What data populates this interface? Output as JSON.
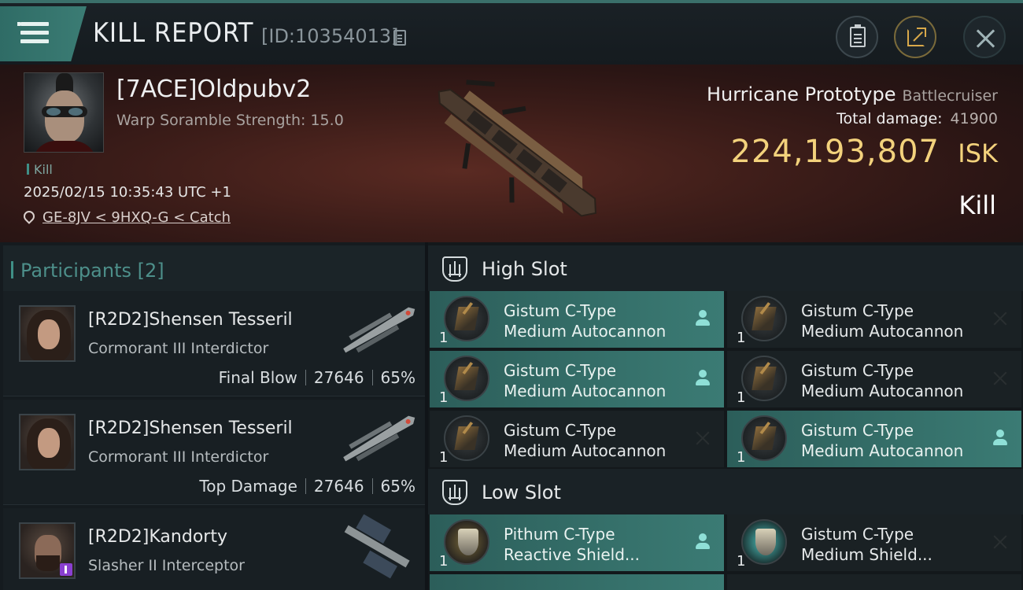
{
  "header": {
    "title": "KILL REPORT",
    "report_id": "[ID:10354013]"
  },
  "victim": {
    "name": "[7ACE]Oldpubv2",
    "warp_scramble": "Warp Soramble Strength: 15.0",
    "tag": "Kill",
    "timestamp": "2025/02/15 10:35:43 UTC +1",
    "location": "GE-8JV < 9HXQ-G < Catch",
    "ship_name": "Hurricane Prototype",
    "ship_class": "Battlecruiser",
    "total_damage_label": "Total damage:",
    "total_damage": "41900",
    "isk_value": "224,193,807",
    "isk_label": "ISK",
    "result": "Kill"
  },
  "participants": {
    "title": "Participants [2]",
    "rows": [
      {
        "name": "[R2D2]Shensen Tesseril",
        "ship": "Cormorant III Interdictor",
        "role": "Final Blow",
        "damage": "27646",
        "percent": "65%"
      },
      {
        "name": "[R2D2]Shensen Tesseril",
        "ship": "Cormorant III Interdictor",
        "role": "Top Damage",
        "damage": "27646",
        "percent": "65%"
      },
      {
        "name": "[R2D2]Kandorty",
        "ship": "Slasher II Interceptor"
      }
    ]
  },
  "slots": {
    "high_title": "High Slot",
    "low_title": "Low Slot",
    "high": [
      {
        "line1": "Gistum C-Type",
        "line2": "Medium Autocannon",
        "qty": "1",
        "state": "dropped"
      },
      {
        "line1": "Gistum C-Type",
        "line2": "Medium Autocannon",
        "qty": "1",
        "state": "destroyed"
      },
      {
        "line1": "Gistum C-Type",
        "line2": "Medium Autocannon",
        "qty": "1",
        "state": "dropped"
      },
      {
        "line1": "Gistum C-Type",
        "line2": "Medium Autocannon",
        "qty": "1",
        "state": "destroyed"
      },
      {
        "line1": "Gistum C-Type",
        "line2": "Medium Autocannon",
        "qty": "1",
        "state": "destroyed"
      },
      {
        "line1": "Gistum C-Type",
        "line2": "Medium Autocannon",
        "qty": "1",
        "state": "dropped"
      }
    ],
    "low": [
      {
        "line1": "Pithum C-Type",
        "line2": "Reactive Shield...",
        "qty": "1",
        "state": "dropped"
      },
      {
        "line1": "Gistum C-Type",
        "line2": "Medium Shield...",
        "qty": "1",
        "state": "destroyed"
      }
    ]
  },
  "colors": {
    "accent": "#3b7b74",
    "isk": "#f3d27c",
    "participants_title": "#4d8f8a"
  }
}
